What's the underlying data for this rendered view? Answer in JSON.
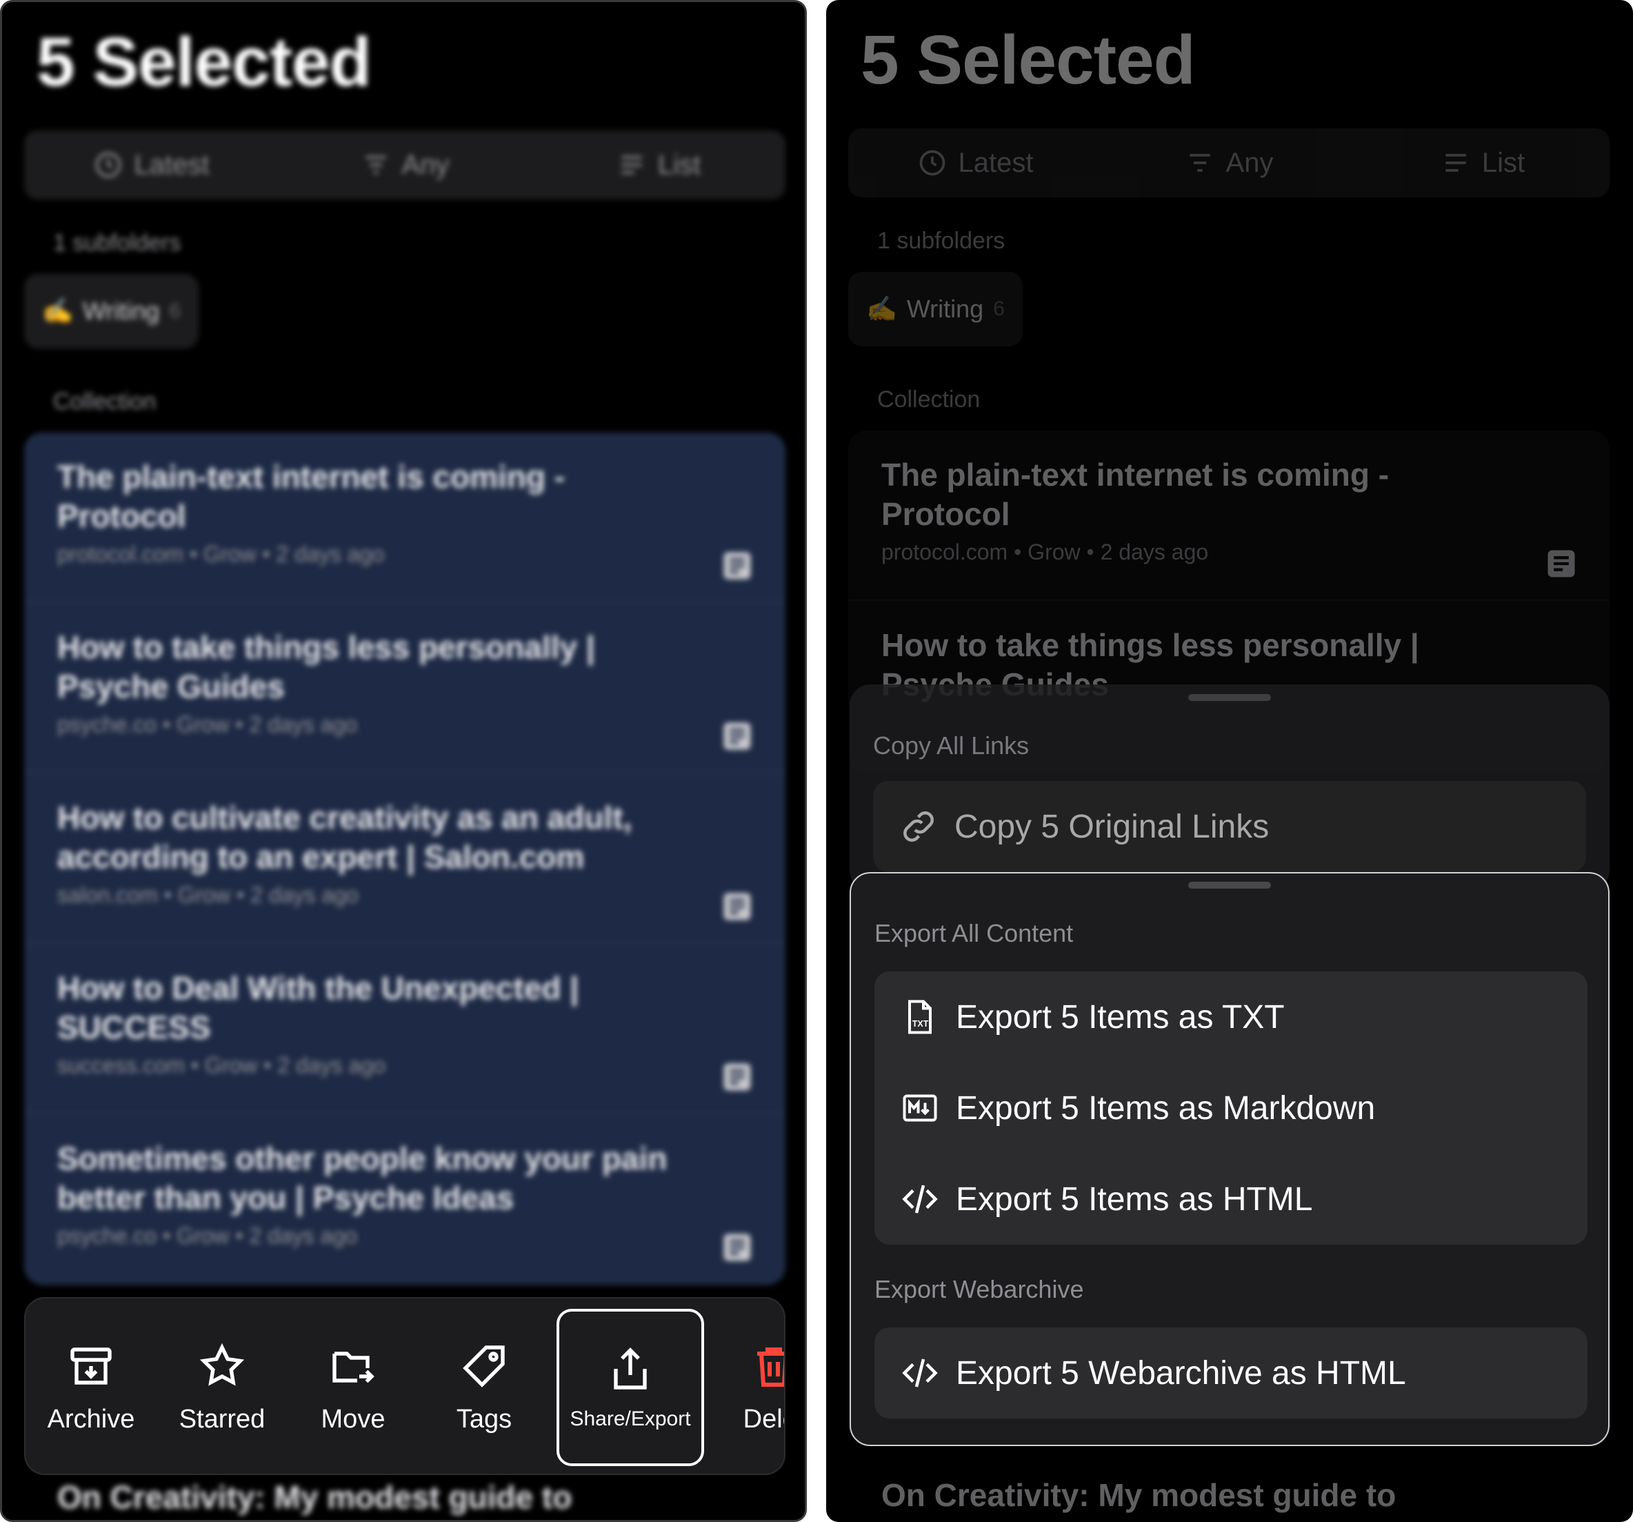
{
  "header": {
    "title": "5 Selected"
  },
  "segments": [
    {
      "label": "Latest",
      "icon": "clock-icon"
    },
    {
      "label": "Any",
      "icon": "filter-icon"
    },
    {
      "label": "List",
      "icon": "list-icon"
    }
  ],
  "subfolders": {
    "label": "1 subfolders",
    "chip": {
      "emoji": "✍️",
      "name": "Writing",
      "count": "6"
    }
  },
  "collection": {
    "label": "Collection"
  },
  "items": [
    {
      "title": "The plain-text internet is coming - Protocol",
      "meta": "protocol.com • Grow • 2 days ago"
    },
    {
      "title": "How to take things less personally | Psyche Guides",
      "meta": "psyche.co • Grow • 2 days ago"
    },
    {
      "title": "How to cultivate creativity as an adult, according to an expert | Salon.com",
      "meta": "salon.com • Grow • 2 days ago"
    },
    {
      "title": "How to Deal With the Unexpected | SUCCESS",
      "meta": "success.com • Grow • 2 days ago"
    },
    {
      "title": "Sometimes other people know your pain better than you | Psyche Ideas",
      "meta": "psyche.co • Grow • 2 days ago"
    }
  ],
  "below_item": {
    "title": "On Creativity: My modest guide to"
  },
  "toolbar": {
    "archive": "Archive",
    "starred": "Starred",
    "move": "Move",
    "tags": "Tags",
    "share": "Share/Export",
    "delete": "Delet"
  },
  "colors": {
    "selected_bg": "#1e2a45",
    "delete": "#ff453a",
    "sheet_bg": "#1c1c1e"
  },
  "copy_sheet": {
    "label": "Copy All Links",
    "option": "Copy 5 Original Links"
  },
  "export_sheet": {
    "content_label": "Export All Content",
    "options": [
      {
        "label": "Export 5 Items as TXT",
        "icon": "txt-file-icon"
      },
      {
        "label": "Export 5 Items as Markdown",
        "icon": "markdown-icon"
      },
      {
        "label": "Export 5 Items as HTML",
        "icon": "code-icon"
      }
    ],
    "webarchive_label": "Export Webarchive",
    "webarchive_option": "Export 5 Webarchive as HTML"
  }
}
